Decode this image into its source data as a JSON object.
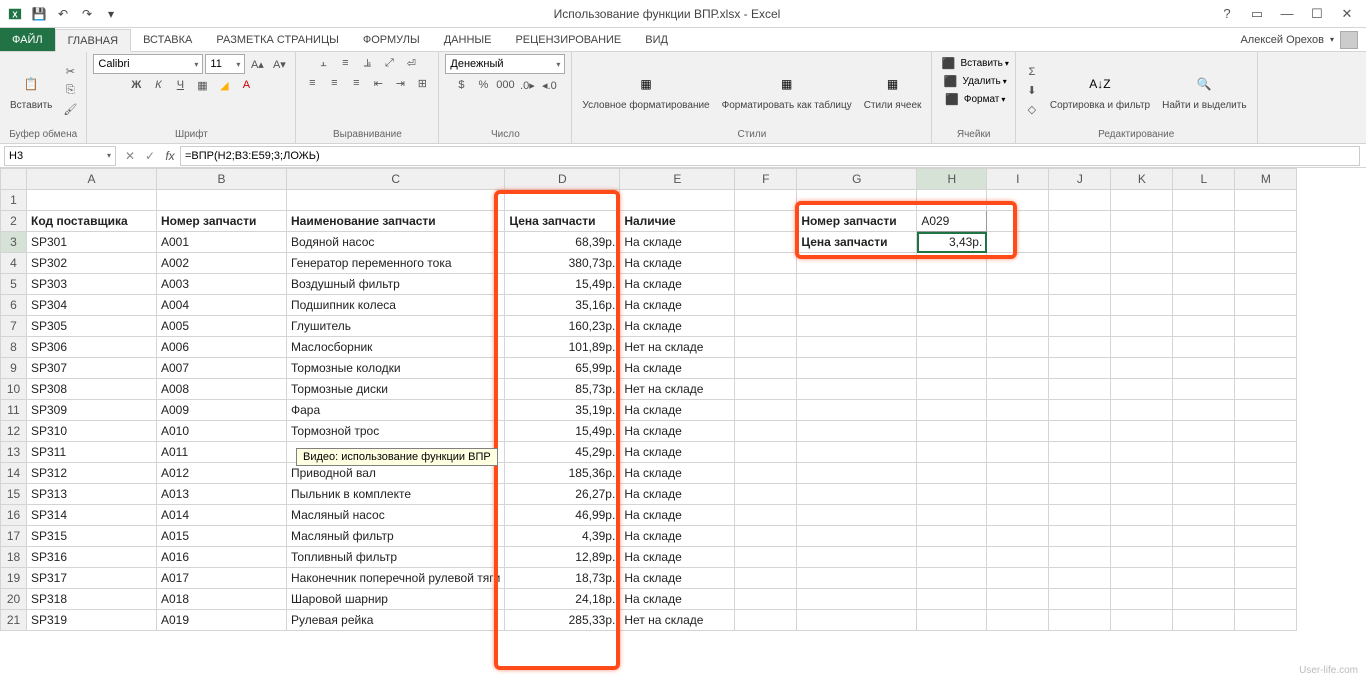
{
  "title": "Использование функции ВПР.xlsx - Excel",
  "user": "Алексей Орехов",
  "tabs": {
    "file": "ФАЙЛ",
    "home": "ГЛАВНАЯ",
    "insert": "ВСТАВКА",
    "layout": "РАЗМЕТКА СТРАНИЦЫ",
    "formulas": "ФОРМУЛЫ",
    "data": "ДАННЫЕ",
    "review": "РЕЦЕНЗИРОВАНИЕ",
    "view": "ВИД"
  },
  "ribbon": {
    "clipboard": {
      "paste": "Вставить",
      "label": "Буфер обмена"
    },
    "font": {
      "name": "Calibri",
      "size": "11",
      "label": "Шрифт",
      "bold": "Ж",
      "italic": "К",
      "underline": "Ч"
    },
    "align": {
      "label": "Выравнивание"
    },
    "number": {
      "format": "Денежный",
      "label": "Число"
    },
    "styles": {
      "cond": "Условное\nформатирование",
      "table": "Форматировать\nкак таблицу",
      "cell": "Стили\nячеек",
      "label": "Стили"
    },
    "cells": {
      "insert": "Вставить",
      "delete": "Удалить",
      "format": "Формат",
      "label": "Ячейки"
    },
    "editing": {
      "sort": "Сортировка\nи фильтр",
      "find": "Найти и\nвыделить",
      "label": "Редактирование"
    }
  },
  "namebox": "H3",
  "formula": "=ВПР(H2;B3:E59;3;ЛОЖЬ)",
  "cols": [
    "A",
    "B",
    "C",
    "D",
    "E",
    "F",
    "G",
    "H",
    "I",
    "J",
    "K",
    "L",
    "M"
  ],
  "headers": {
    "a": "Код поставщика",
    "b": "Номер запчасти",
    "c": "Наименование запчасти",
    "d": "Цена запчасти",
    "e": "Наличие"
  },
  "lookup": {
    "g2": "Номер запчасти",
    "h2": "A029",
    "g3": "Цена запчасти",
    "h3": "3,43р."
  },
  "rows": [
    {
      "r": 3,
      "a": "SP301",
      "b": "A001",
      "c": "Водяной насос",
      "d": "68,39р.",
      "e": "На складе"
    },
    {
      "r": 4,
      "a": "SP302",
      "b": "A002",
      "c": "Генератор переменного тока",
      "d": "380,73р.",
      "e": "На складе"
    },
    {
      "r": 5,
      "a": "SP303",
      "b": "A003",
      "c": "Воздушный фильтр",
      "d": "15,49р.",
      "e": "На складе"
    },
    {
      "r": 6,
      "a": "SP304",
      "b": "A004",
      "c": "Подшипник колеса",
      "d": "35,16р.",
      "e": "На складе"
    },
    {
      "r": 7,
      "a": "SP305",
      "b": "A005",
      "c": "Глушитель",
      "d": "160,23р.",
      "e": "На складе"
    },
    {
      "r": 8,
      "a": "SP306",
      "b": "A006",
      "c": "Маслосборник",
      "d": "101,89р.",
      "e": "Нет на складе"
    },
    {
      "r": 9,
      "a": "SP307",
      "b": "A007",
      "c": "Тормозные колодки",
      "d": "65,99р.",
      "e": "На складе"
    },
    {
      "r": 10,
      "a": "SP308",
      "b": "A008",
      "c": "Тормозные диски",
      "d": "85,73р.",
      "e": "Нет на складе"
    },
    {
      "r": 11,
      "a": "SP309",
      "b": "A009",
      "c": "Фара",
      "d": "35,19р.",
      "e": "На складе"
    },
    {
      "r": 12,
      "a": "SP310",
      "b": "A010",
      "c": "Тормозной трос",
      "d": "15,49р.",
      "e": "На складе"
    },
    {
      "r": 13,
      "a": "SP311",
      "b": "A011",
      "c": "",
      "d": "45,29р.",
      "e": "На складе"
    },
    {
      "r": 14,
      "a": "SP312",
      "b": "A012",
      "c": "Приводной вал",
      "d": "185,36р.",
      "e": "На складе"
    },
    {
      "r": 15,
      "a": "SP313",
      "b": "A013",
      "c": "Пыльник в комплекте",
      "d": "26,27р.",
      "e": "На складе"
    },
    {
      "r": 16,
      "a": "SP314",
      "b": "A014",
      "c": "Масляный насос",
      "d": "46,99р.",
      "e": "На складе"
    },
    {
      "r": 17,
      "a": "SP315",
      "b": "A015",
      "c": "Масляный фильтр",
      "d": "4,39р.",
      "e": "На складе"
    },
    {
      "r": 18,
      "a": "SP316",
      "b": "A016",
      "c": "Топливный фильтр",
      "d": "12,89р.",
      "e": "На складе"
    },
    {
      "r": 19,
      "a": "SP317",
      "b": "A017",
      "c": "Наконечник поперечной рулевой тяги",
      "d": "18,73р.",
      "e": "На складе"
    },
    {
      "r": 20,
      "a": "SP318",
      "b": "A018",
      "c": "Шаровой шарнир",
      "d": "24,18р.",
      "e": "На складе"
    },
    {
      "r": 21,
      "a": "SP319",
      "b": "A019",
      "c": "Рулевая рейка",
      "d": "285,33р.",
      "e": "Нет на складе"
    }
  ],
  "tooltip": "Видео: использование функции ВПР",
  "watermark": "User-life.com"
}
